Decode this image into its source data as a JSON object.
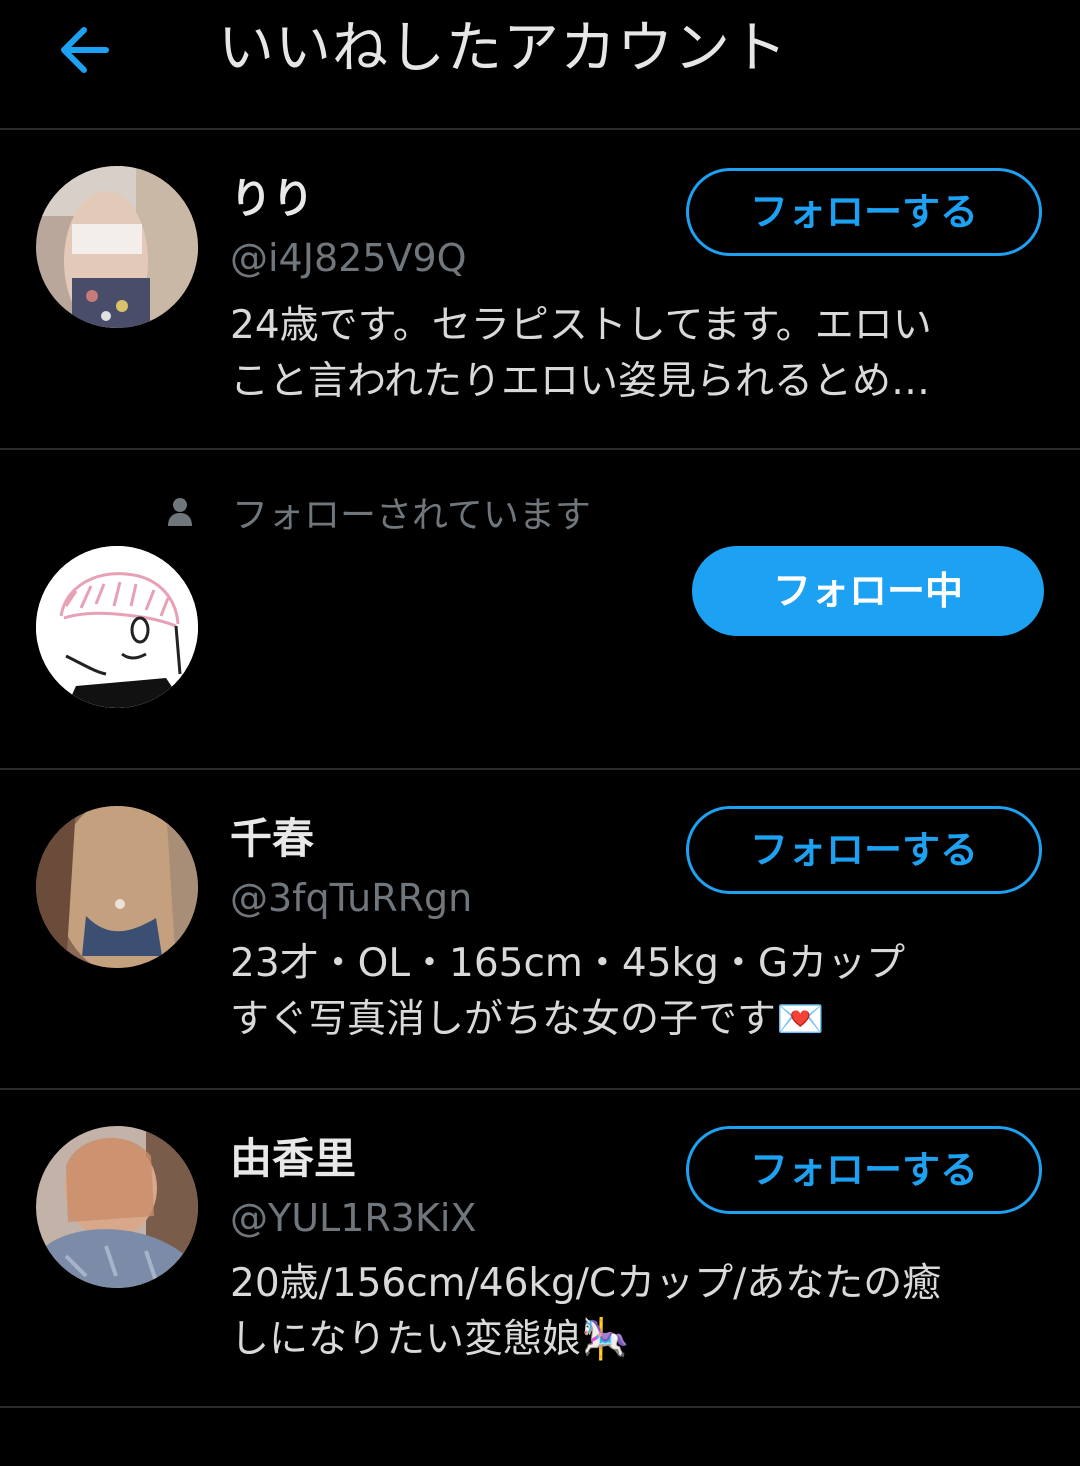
{
  "header": {
    "back_icon": "arrow-left-icon",
    "title": "いいねしたアカウント",
    "accent_color": "#1da1f2"
  },
  "users": [
    {
      "name": "りり",
      "handle": "@i4J825V9Q",
      "bio_lines": [
        "24歳です。セラピストしてます。エロい",
        "こと言われたりエロい姿見られるとめ…"
      ],
      "button_label": "フォローする"
    },
    {
      "follows_you_icon": "person-icon",
      "follows_you": "フォローされています",
      "button_label": "フォロー中"
    },
    {
      "name": "千春",
      "handle": "@3fqTuRRgn",
      "bio_lines": [
        "23才・OL・165cm・45kg・Gカップ",
        "すぐ写真消しがちな女の子です💌"
      ],
      "button_label": "フォローする"
    },
    {
      "name": "由香里",
      "handle": "@YUL1R3KiX",
      "bio_lines": [
        "20歳/156cm/46kg/Cカップ/あなたの癒",
        "しになりたい変態娘🎠"
      ],
      "button_label": "フォローする"
    }
  ]
}
